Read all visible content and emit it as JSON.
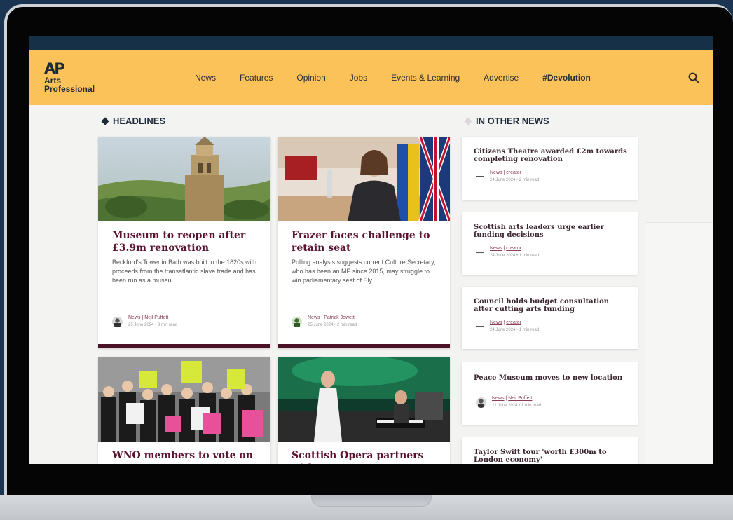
{
  "site": {
    "logo_mark": "AP",
    "logo_line1": "Arts",
    "logo_line2": "Professional"
  },
  "nav": {
    "items": [
      "News",
      "Features",
      "Opinion",
      "Jobs",
      "Events & Learning",
      "Advertise",
      "#Devolution"
    ],
    "search_icon": "search-icon"
  },
  "headlines": {
    "title": "HEADLINES",
    "cards": [
      {
        "title": "Museum to reopen after £3.9m renovation",
        "excerpt": "Beckford's Tower in Bath was built in the 1820s with proceeds from the transatlantic slave trade and has been run as a museu...",
        "category": "News",
        "author": "Neil Puffett",
        "date": "25 June 2024",
        "read_time": "3 min read"
      },
      {
        "title": "Frazer faces challenge to retain seat",
        "excerpt": "Polling analysis suggests current Culture Secretary, who has been an MP since 2015, may struggle to win parliamentary seat of Ely...",
        "category": "News",
        "author": "Patrick Jowett",
        "date": "25 June 2024",
        "read_time": "2 min read"
      },
      {
        "title": "WNO members to vote on"
      },
      {
        "title": "Scottish Opera partners with"
      }
    ]
  },
  "other_news": {
    "title": "IN OTHER NEWS",
    "items": [
      {
        "title": "Citizens Theatre awarded £2m towards completing renovation",
        "category": "News",
        "author": "creator",
        "date": "24 June 2024",
        "read_time": "2 min read"
      },
      {
        "title": "Scottish arts leaders urge earlier funding decisions",
        "category": "News",
        "author": "creator",
        "date": "24 June 2024",
        "read_time": "1 min read"
      },
      {
        "title": "Council holds budget consultation after cutting arts funding",
        "category": "News",
        "author": "creator",
        "date": "24 June 2024",
        "read_time": "1 min read"
      },
      {
        "title": "Peace Museum moves to new location",
        "category": "News",
        "author": "Neil Puffett",
        "date": "21 June 2024",
        "read_time": "1 min read"
      },
      {
        "title": "Taylor Swift tour 'worth £300m to London economy'"
      }
    ]
  },
  "separators": {
    "meta": " | ",
    "dot": "•"
  },
  "colors": {
    "nav_bg": "#fbc25a",
    "top_strip": "#163048",
    "title_maroon": "#5b1230",
    "card_bar": "#4a1127",
    "page_bg": "#1b3451"
  }
}
